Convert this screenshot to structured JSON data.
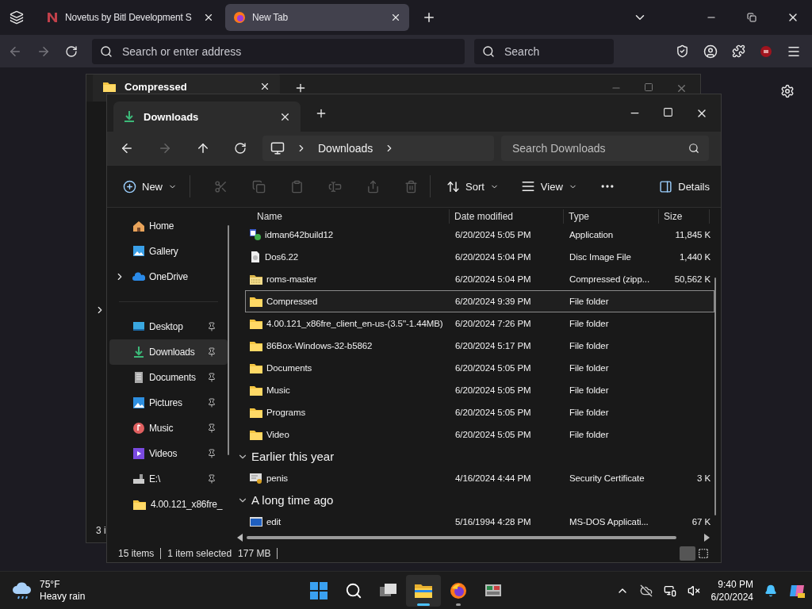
{
  "browser": {
    "tabs": [
      {
        "title": "Novetus by Bitl Development S",
        "kind": "logo",
        "selected": false
      },
      {
        "title": "New Tab",
        "kind": "firefox",
        "selected": true
      }
    ],
    "address": {
      "placeholder": "Search or enter address"
    },
    "search": {
      "placeholder": "Search"
    }
  },
  "background_window": {
    "tab": {
      "title": "Compressed"
    },
    "status_bar": {
      "items": "3 i"
    }
  },
  "explorer": {
    "tab": {
      "title": "Downloads"
    },
    "breadcrumb": [
      "Downloads"
    ],
    "search": {
      "placeholder": "Search Downloads"
    },
    "toolbar": {
      "new": "New",
      "sort": "Sort",
      "view": "View",
      "details": "Details"
    },
    "sidebar": [
      {
        "label": "Home",
        "kind": "home",
        "pinned": false,
        "selected": false
      },
      {
        "label": "Gallery",
        "kind": "gallery",
        "pinned": false,
        "selected": false
      },
      {
        "label": "OneDrive",
        "kind": "cloud",
        "pinned": false,
        "selected": false,
        "expanded": false
      },
      {
        "label": "Desktop",
        "kind": "desktop",
        "pinned": true,
        "selected": false
      },
      {
        "label": "Downloads",
        "kind": "downloads",
        "pinned": true,
        "selected": true
      },
      {
        "label": "Documents",
        "kind": "documents",
        "pinned": true,
        "selected": false
      },
      {
        "label": "Pictures",
        "kind": "pictures",
        "pinned": true,
        "selected": false
      },
      {
        "label": "Music",
        "kind": "music",
        "pinned": true,
        "selected": false
      },
      {
        "label": "Videos",
        "kind": "videos",
        "pinned": true,
        "selected": false
      },
      {
        "label": "E:\\",
        "kind": "drive",
        "pinned": true,
        "selected": false
      },
      {
        "label": "4.00.121_x86fre_",
        "kind": "folder",
        "pinned": false,
        "selected": false
      }
    ],
    "columns": [
      "Name",
      "Date modified",
      "Type",
      "Size"
    ],
    "sections": [
      {
        "files": [
          {
            "name": "idman642build12",
            "date": "6/20/2024 5:05 PM",
            "type": "Application",
            "size": "11,845 K",
            "kind": "app",
            "selected": false
          },
          {
            "name": "Dos6.22",
            "date": "6/20/2024 5:04 PM",
            "type": "Disc Image File",
            "size": "1,440 K",
            "kind": "disc",
            "selected": false
          },
          {
            "name": "roms-master",
            "date": "6/20/2024 5:04 PM",
            "type": "Compressed (zipp...",
            "size": "50,562 K",
            "kind": "archive",
            "selected": false
          },
          {
            "name": "Compressed",
            "date": "6/20/2024 9:39 PM",
            "type": "File folder",
            "kind": "folder",
            "selected": true
          },
          {
            "name": "4.00.121_x86fre_client_en-us-(3.5''-1.44MB)",
            "date": "6/20/2024 7:26 PM",
            "type": "File folder",
            "kind": "folder",
            "selected": false
          },
          {
            "name": "86Box-Windows-32-b5862",
            "date": "6/20/2024 5:17 PM",
            "type": "File folder",
            "kind": "folder",
            "selected": false
          },
          {
            "name": "Documents",
            "date": "6/20/2024 5:05 PM",
            "type": "File folder",
            "kind": "folder",
            "selected": false
          },
          {
            "name": "Music",
            "date": "6/20/2024 5:05 PM",
            "type": "File folder",
            "kind": "folder",
            "selected": false
          },
          {
            "name": "Programs",
            "date": "6/20/2024 5:05 PM",
            "type": "File folder",
            "kind": "folder",
            "selected": false
          },
          {
            "name": "Video",
            "date": "6/20/2024 5:05 PM",
            "type": "File folder",
            "kind": "folder",
            "selected": false
          }
        ]
      },
      {
        "label": "Earlier this year",
        "expanded": true,
        "files": [
          {
            "name": "penis",
            "date": "4/16/2024 4:44 PM",
            "type": "Security Certificate",
            "size": "3 K",
            "kind": "certificate",
            "selected": false
          }
        ]
      },
      {
        "label": "A long time ago",
        "expanded": true,
        "files": [
          {
            "name": "edit",
            "date": "5/16/1994 4:28 PM",
            "type": "MS-DOS Applicati...",
            "size": "67 K",
            "kind": "dos",
            "selected": false
          }
        ]
      }
    ],
    "status_bar": {
      "count": "15 items",
      "selection": "1 item selected",
      "size": "177 MB"
    },
    "view_modes": [
      {
        "kind": "details",
        "selected": true
      },
      {
        "kind": "tiles",
        "selected": false
      }
    ]
  },
  "taskbar": {
    "weather": {
      "temperature": "75°F",
      "condition": "Heavy rain"
    },
    "apps": [
      {
        "kind": "start",
        "running": false,
        "active": false
      },
      {
        "kind": "search",
        "running": false,
        "active": false
      },
      {
        "kind": "taskview",
        "running": false,
        "active": false
      },
      {
        "kind": "explorer",
        "running": true,
        "active": true
      },
      {
        "kind": "firefox",
        "running": true,
        "active": false
      },
      {
        "kind": "emulator",
        "running": false,
        "active": false
      }
    ],
    "time": "9:40 PM",
    "date": "6/20/2024"
  }
}
